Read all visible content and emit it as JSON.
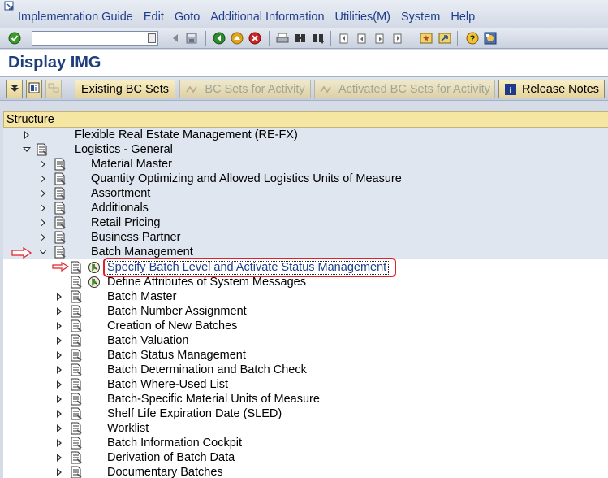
{
  "menu": {
    "items": [
      "Implementation Guide",
      "Edit",
      "Goto",
      "Additional Information",
      "Utilities(M)",
      "System",
      "Help"
    ]
  },
  "toolbar": {
    "command_value": "",
    "icons": [
      "enter-checkmark-icon",
      "save-icon",
      "back-icon",
      "exit-icon",
      "cancel-icon",
      "print-icon",
      "find-icon",
      "find-next-icon",
      "first-page-icon",
      "previous-page-icon",
      "next-page-icon",
      "last-page-icon",
      "create-session-icon",
      "shortcut-icon",
      "help-icon",
      "layout-menu-icon"
    ]
  },
  "title": "Display IMG",
  "app_toolbar": {
    "existing_bc_sets": "Existing BC Sets",
    "bc_sets_activity": "BC Sets for Activity",
    "activated_bc_sets": "Activated BC Sets for Activity",
    "release_notes": "Release Notes"
  },
  "tree": {
    "header": "Structure",
    "rows": [
      {
        "label": "Flexible Real Estate Management (RE-FX)",
        "level": 1,
        "state": "collapsed"
      },
      {
        "label": "Logistics - General",
        "level": 1,
        "state": "expanded"
      },
      {
        "label": "Material Master",
        "level": 2,
        "state": "collapsed"
      },
      {
        "label": "Quantity Optimizing and Allowed Logistics Units of Measure",
        "level": 2,
        "state": "collapsed"
      },
      {
        "label": "Assortment",
        "level": 2,
        "state": "collapsed"
      },
      {
        "label": "Additionals",
        "level": 2,
        "state": "collapsed"
      },
      {
        "label": "Retail Pricing",
        "level": 2,
        "state": "collapsed"
      },
      {
        "label": "Business Partner",
        "level": 2,
        "state": "collapsed"
      },
      {
        "label": "Batch Management",
        "level": 2,
        "state": "expanded"
      },
      {
        "label": "Specify Batch Level and Activate Status Management",
        "level": 3,
        "state": "activity",
        "selected": true
      },
      {
        "label": "Define Attributes of System Messages",
        "level": 3,
        "state": "activity"
      },
      {
        "label": "Batch Master",
        "level": 3,
        "state": "collapsed"
      },
      {
        "label": "Batch Number Assignment",
        "level": 3,
        "state": "collapsed"
      },
      {
        "label": "Creation of New Batches",
        "level": 3,
        "state": "collapsed"
      },
      {
        "label": "Batch Valuation",
        "level": 3,
        "state": "collapsed"
      },
      {
        "label": "Batch Status Management",
        "level": 3,
        "state": "collapsed"
      },
      {
        "label": "Batch Determination and Batch Check",
        "level": 3,
        "state": "collapsed"
      },
      {
        "label": "Batch Where-Used List",
        "level": 3,
        "state": "collapsed"
      },
      {
        "label": "Batch-Specific Material Units of Measure",
        "level": 3,
        "state": "collapsed"
      },
      {
        "label": "Shelf Life Expiration Date (SLED)",
        "level": 3,
        "state": "collapsed"
      },
      {
        "label": "Worklist",
        "level": 3,
        "state": "collapsed"
      },
      {
        "label": "Batch Information Cockpit",
        "level": 3,
        "state": "collapsed"
      },
      {
        "label": "Derivation of Batch Data",
        "level": 3,
        "state": "collapsed"
      },
      {
        "label": "Documentary Batches",
        "level": 3,
        "state": "collapsed"
      }
    ]
  },
  "colors": {
    "link": "#1f3f8c",
    "title": "#1e3f7c",
    "highlight": "#e0202a",
    "tree_header": "#f5e6a4"
  }
}
